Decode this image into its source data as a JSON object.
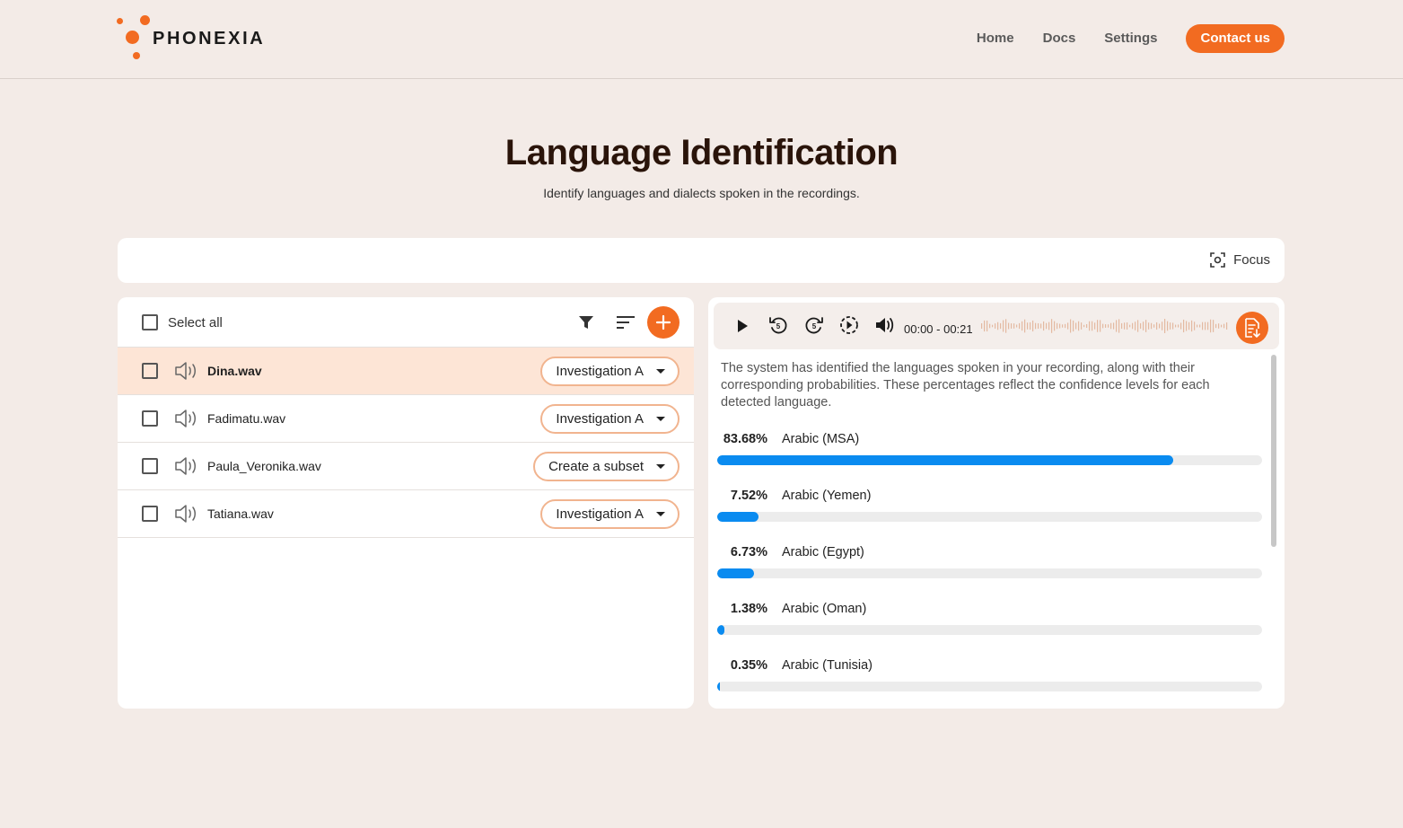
{
  "header": {
    "brand": "PHONEXIA",
    "nav": [
      "Home",
      "Docs",
      "Settings"
    ],
    "contact_label": "Contact us"
  },
  "page": {
    "title": "Language Identification",
    "subtitle": "Identify languages and dialects spoken in the recordings."
  },
  "focus_bar": {
    "focus_label": "Focus"
  },
  "file_list": {
    "select_all_label": "Select all",
    "files": [
      {
        "name": "Dina.wav",
        "group": "Investigation A",
        "selected": true
      },
      {
        "name": "Fadimatu.wav",
        "group": "Investigation A",
        "selected": false
      },
      {
        "name": "Paula_Veronika.wav",
        "group": "Create a subset",
        "selected": false
      },
      {
        "name": "Tatiana.wav",
        "group": "Investigation A",
        "selected": false
      }
    ]
  },
  "player": {
    "time": "00:00 - 00:21"
  },
  "results": {
    "description": "The system has identified the languages spoken in your recording, along with their corresponding probabilities. These percentages reflect the confidence levels for each detected language.",
    "languages": [
      {
        "percent": "83.68%",
        "value": 83.68,
        "name": "Arabic (MSA)"
      },
      {
        "percent": "7.52%",
        "value": 7.52,
        "name": "Arabic (Yemen)"
      },
      {
        "percent": "6.73%",
        "value": 6.73,
        "name": "Arabic (Egypt)"
      },
      {
        "percent": "1.38%",
        "value": 1.38,
        "name": "Arabic (Oman)"
      },
      {
        "percent": "0.35%",
        "value": 0.35,
        "name": "Arabic (Tunisia)"
      }
    ]
  },
  "colors": {
    "accent": "#f26b21",
    "bar": "#0a8bf0",
    "background": "#f3ebe7",
    "selected_row": "#fde5d6"
  }
}
